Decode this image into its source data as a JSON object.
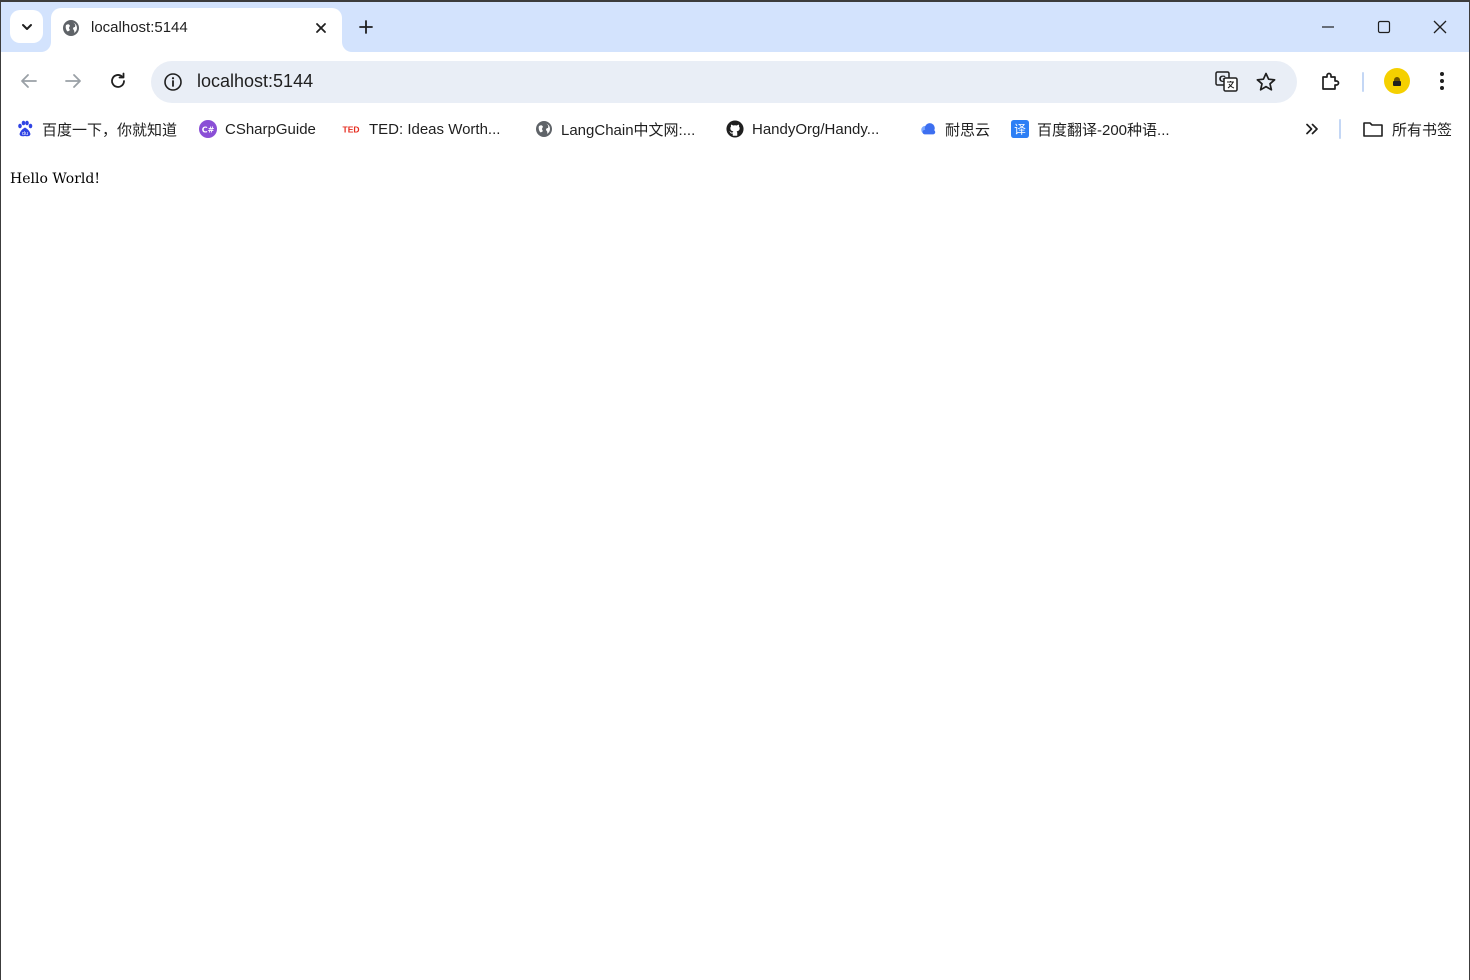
{
  "tab": {
    "title": "localhost:5144"
  },
  "omnibox": {
    "url": "localhost:5144"
  },
  "bookmarks": [
    {
      "label": "百度一下，你就知道",
      "icon": "baidu-paw-icon"
    },
    {
      "label": "CSharpGuide",
      "icon": "csharp-icon"
    },
    {
      "label": "TED: Ideas Worth...",
      "icon": "ted-icon"
    },
    {
      "label": "LangChain中文网:...",
      "icon": "globe-icon"
    },
    {
      "label": "HandyOrg/Handy...",
      "icon": "github-icon"
    },
    {
      "label": "耐思云",
      "icon": "cloud-icon"
    },
    {
      "label": "百度翻译-200种语...",
      "icon": "baidu-translate-icon"
    }
  ],
  "all_bookmarks_label": "所有书签",
  "page": {
    "text": "Hello World!"
  },
  "colors": {
    "tabstrip": "#d3e3fd",
    "omnibox": "#e9eef6",
    "profile": "#f5d000"
  }
}
